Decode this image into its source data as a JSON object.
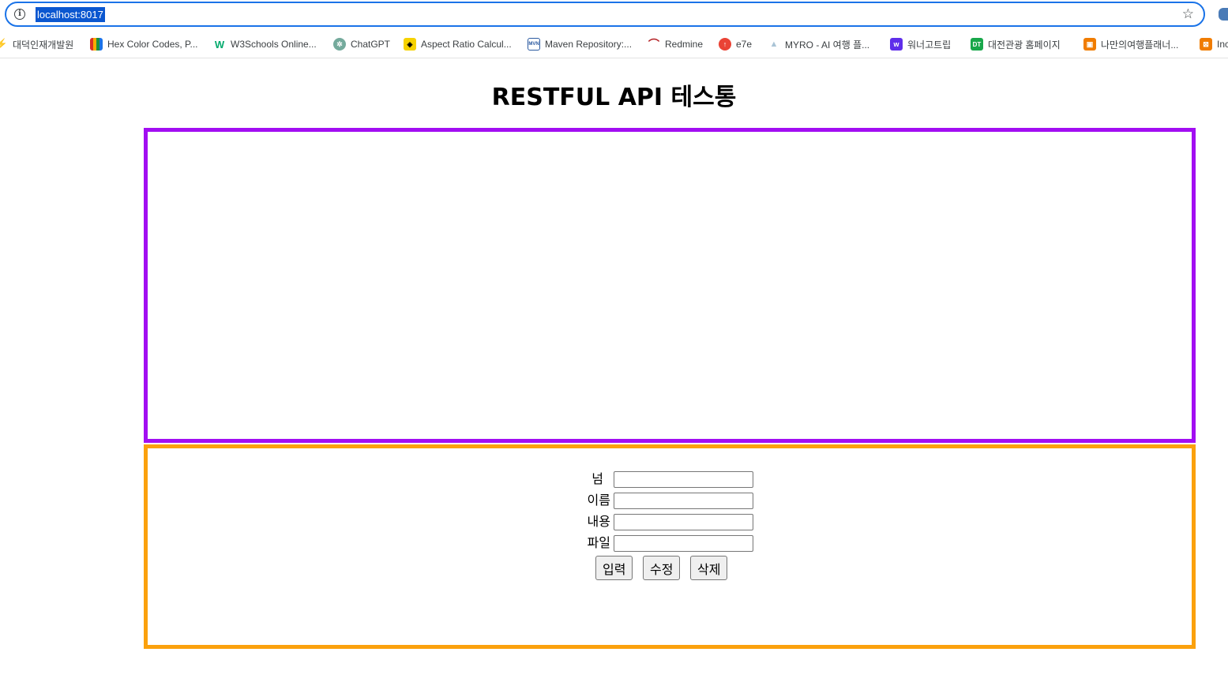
{
  "browser": {
    "url": "localhost:8017",
    "bookmarks": [
      {
        "label": "대덕인재개발원",
        "icon": "bolt-icon",
        "color": "#f29900"
      },
      {
        "label": "Hex Color Codes, P...",
        "icon": "color-bars-icon",
        "color": "#d93025"
      },
      {
        "label": "W3Schools Online...",
        "icon": "w3schools-icon",
        "color": "#04aa6d"
      },
      {
        "label": "ChatGPT",
        "icon": "chatgpt-icon",
        "color": "#74aa9c"
      },
      {
        "label": "Aspect Ratio Calcul...",
        "icon": "aspect-ratio-icon",
        "color": "#f6d200"
      },
      {
        "label": "Maven Repository:...",
        "icon": "maven-icon",
        "color": "#2b5aa0"
      },
      {
        "label": "Redmine",
        "icon": "redmine-icon",
        "color": "#b32024"
      },
      {
        "label": "e7e",
        "icon": "e7e-icon",
        "color": "#ea4335"
      },
      {
        "label": "MYRO - AI 여행 플...",
        "icon": "myro-icon",
        "color": "#c8d6e0"
      },
      {
        "label": "워너고트립",
        "icon": "wannago-icon",
        "color": "#5f2eea"
      },
      {
        "label": "대전관광 홈페이지",
        "icon": "daejeon-tour-icon",
        "color": "#18a74a"
      },
      {
        "label": "나만의여행플래너...",
        "icon": "travel-planner-icon",
        "color": "#f07c00"
      },
      {
        "label": "Inc",
        "icon": "bookmark-icon",
        "color": "#f07c00"
      }
    ]
  },
  "page": {
    "title": "RESTFUL API 테스통"
  },
  "form": {
    "fields": [
      {
        "label": "넘",
        "value": ""
      },
      {
        "label": "이름",
        "value": ""
      },
      {
        "label": "내용",
        "value": ""
      },
      {
        "label": "파일",
        "value": ""
      }
    ],
    "buttons": {
      "insert": "입력",
      "update": "수정",
      "delete": "삭제"
    }
  },
  "colors": {
    "list_border": "#a20ef2",
    "form_border": "#fba10d",
    "url_highlight": "#0b57d0"
  }
}
